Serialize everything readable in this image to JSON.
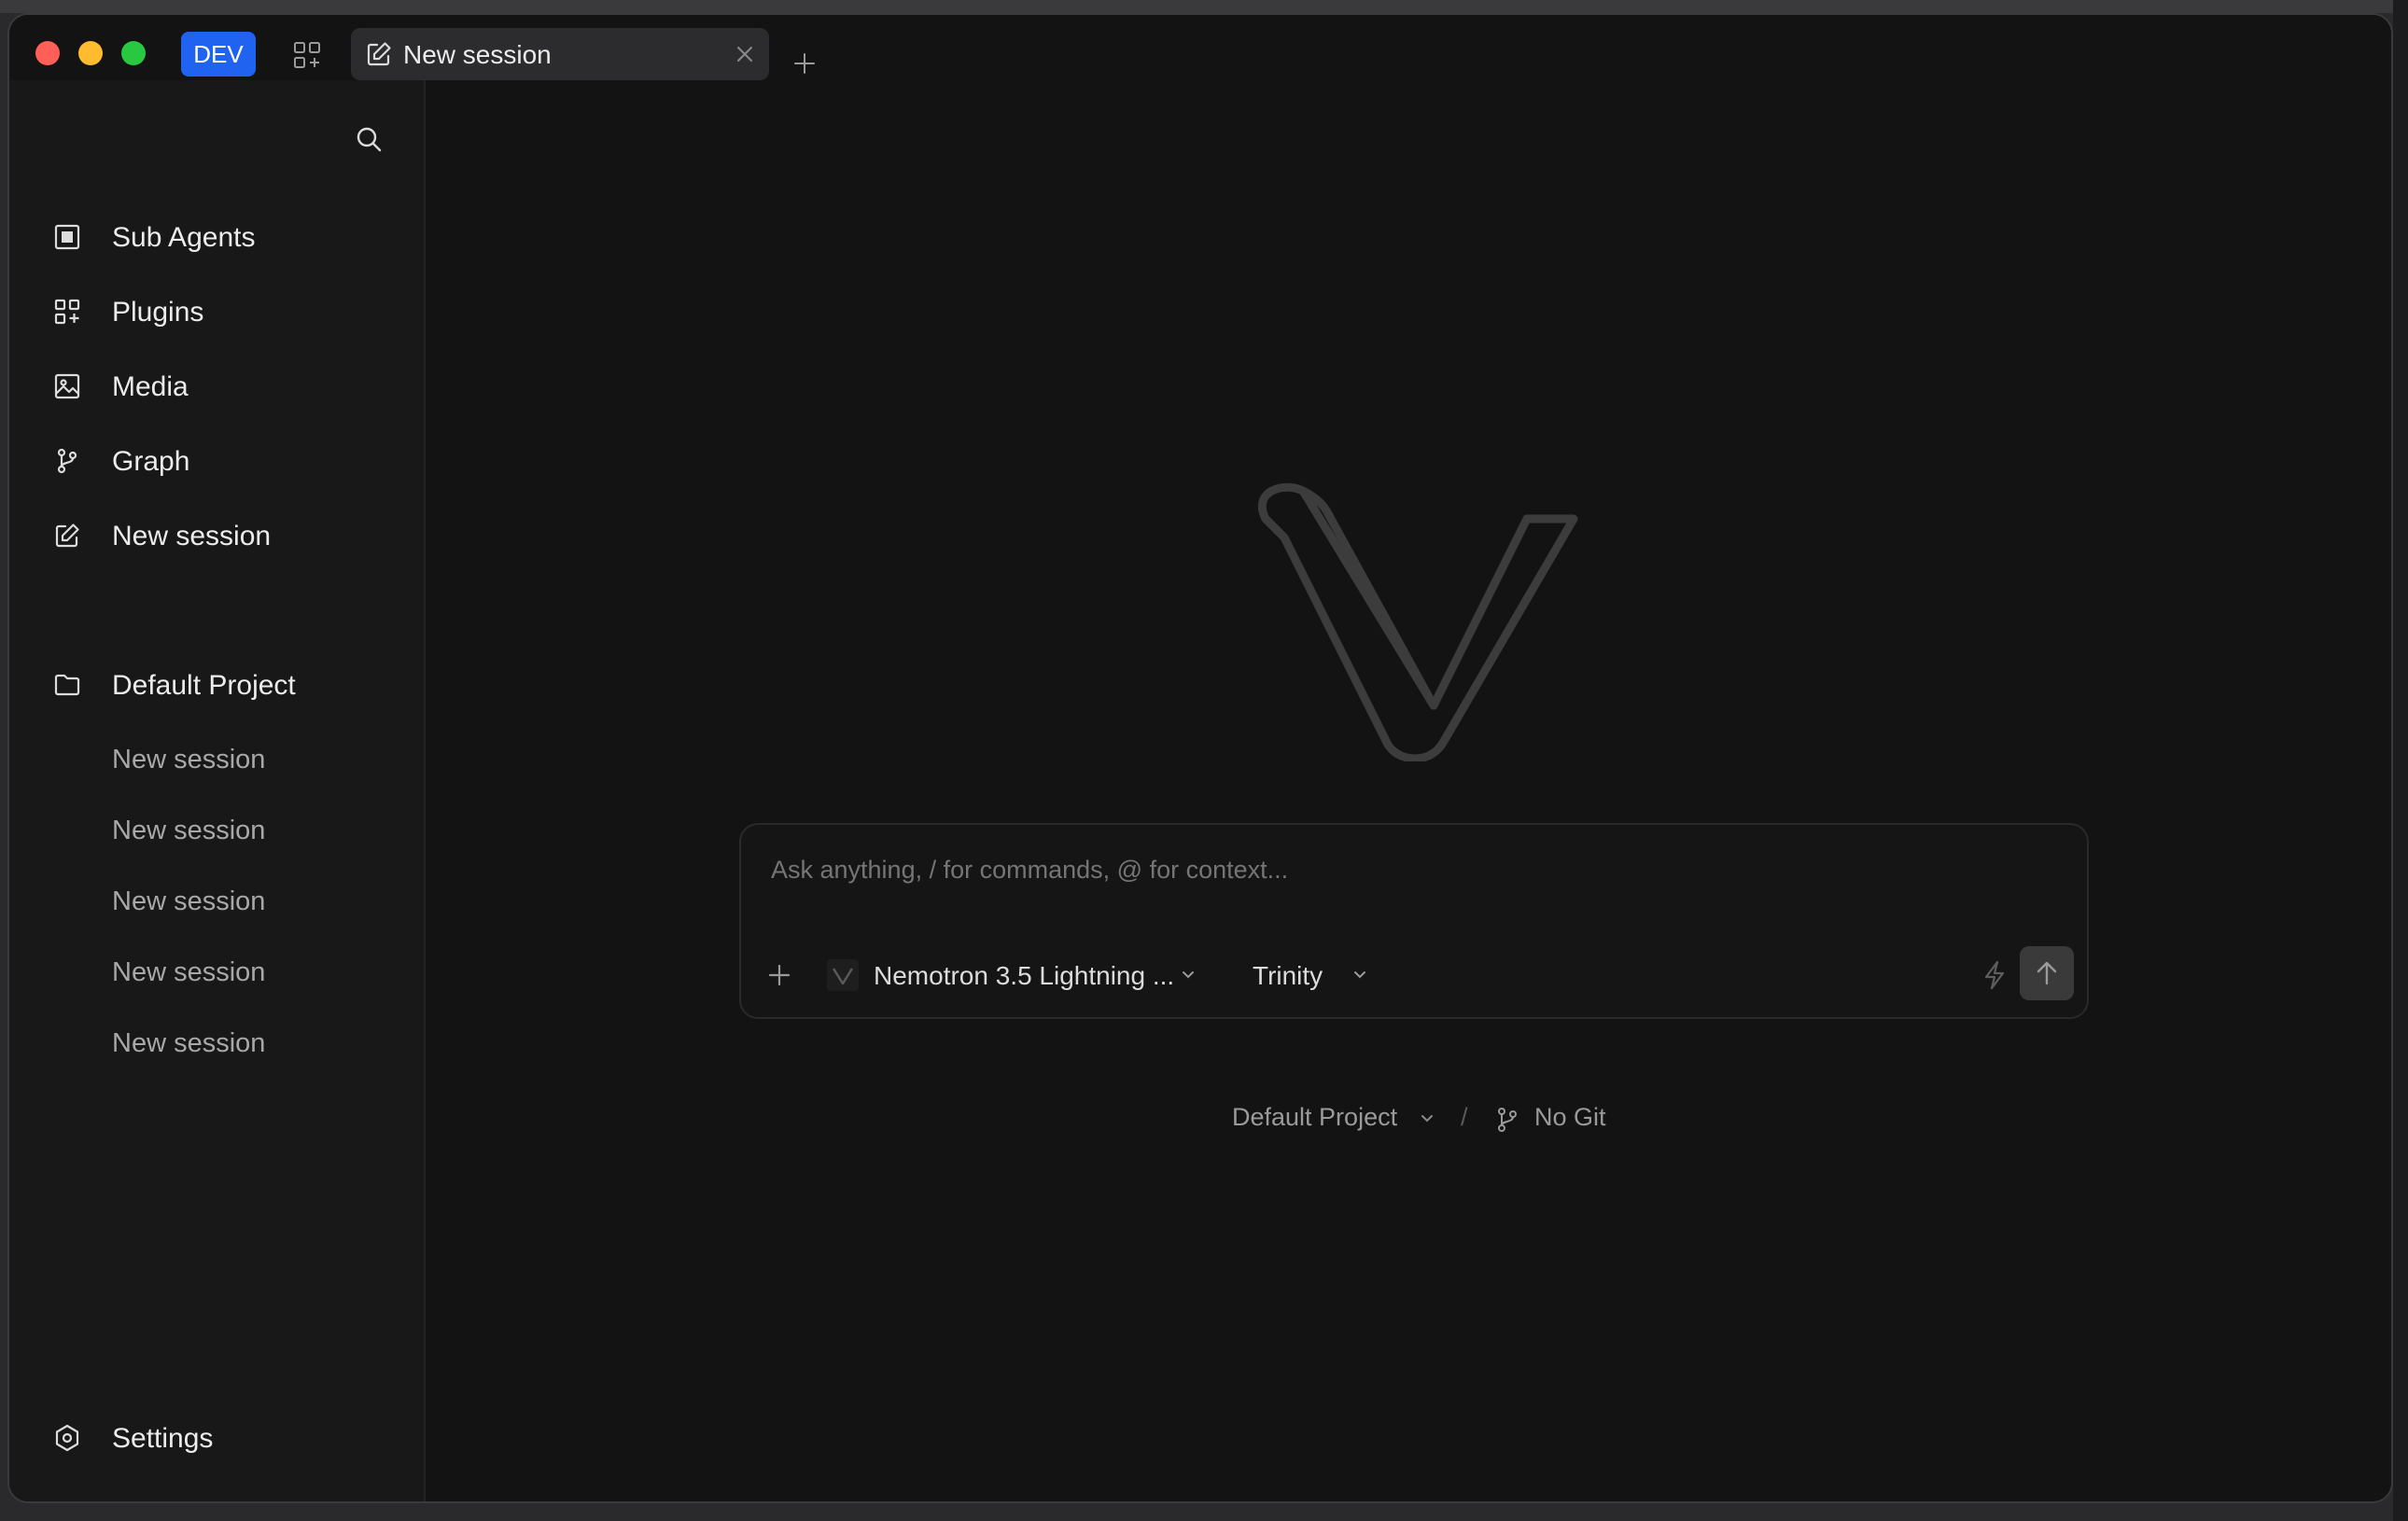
{
  "titlebar": {
    "env_badge": "DEV",
    "active_tab": {
      "label": "New session"
    }
  },
  "sidebar": {
    "nav": [
      {
        "label": "Sub Agents",
        "icon": "sub-agents-icon"
      },
      {
        "label": "Plugins",
        "icon": "plugins-icon"
      },
      {
        "label": "Media",
        "icon": "image-icon"
      },
      {
        "label": "Graph",
        "icon": "git-branch-icon"
      },
      {
        "label": "New session",
        "icon": "edit-icon"
      }
    ],
    "project": {
      "label": "Default Project",
      "icon": "folder-icon"
    },
    "sessions": [
      "New session",
      "New session",
      "New session",
      "New session",
      "New session"
    ],
    "settings_label": "Settings"
  },
  "composer": {
    "placeholder": "Ask anything, / for commands, @ for context...",
    "model": "Nemotron 3.5 Lightning ...",
    "agent": "Trinity"
  },
  "footer": {
    "project": "Default Project",
    "separator": "/",
    "git": "No Git"
  },
  "colors": {
    "accent": "#1f63f0",
    "background": "#131313",
    "sidebar": "#181818"
  }
}
